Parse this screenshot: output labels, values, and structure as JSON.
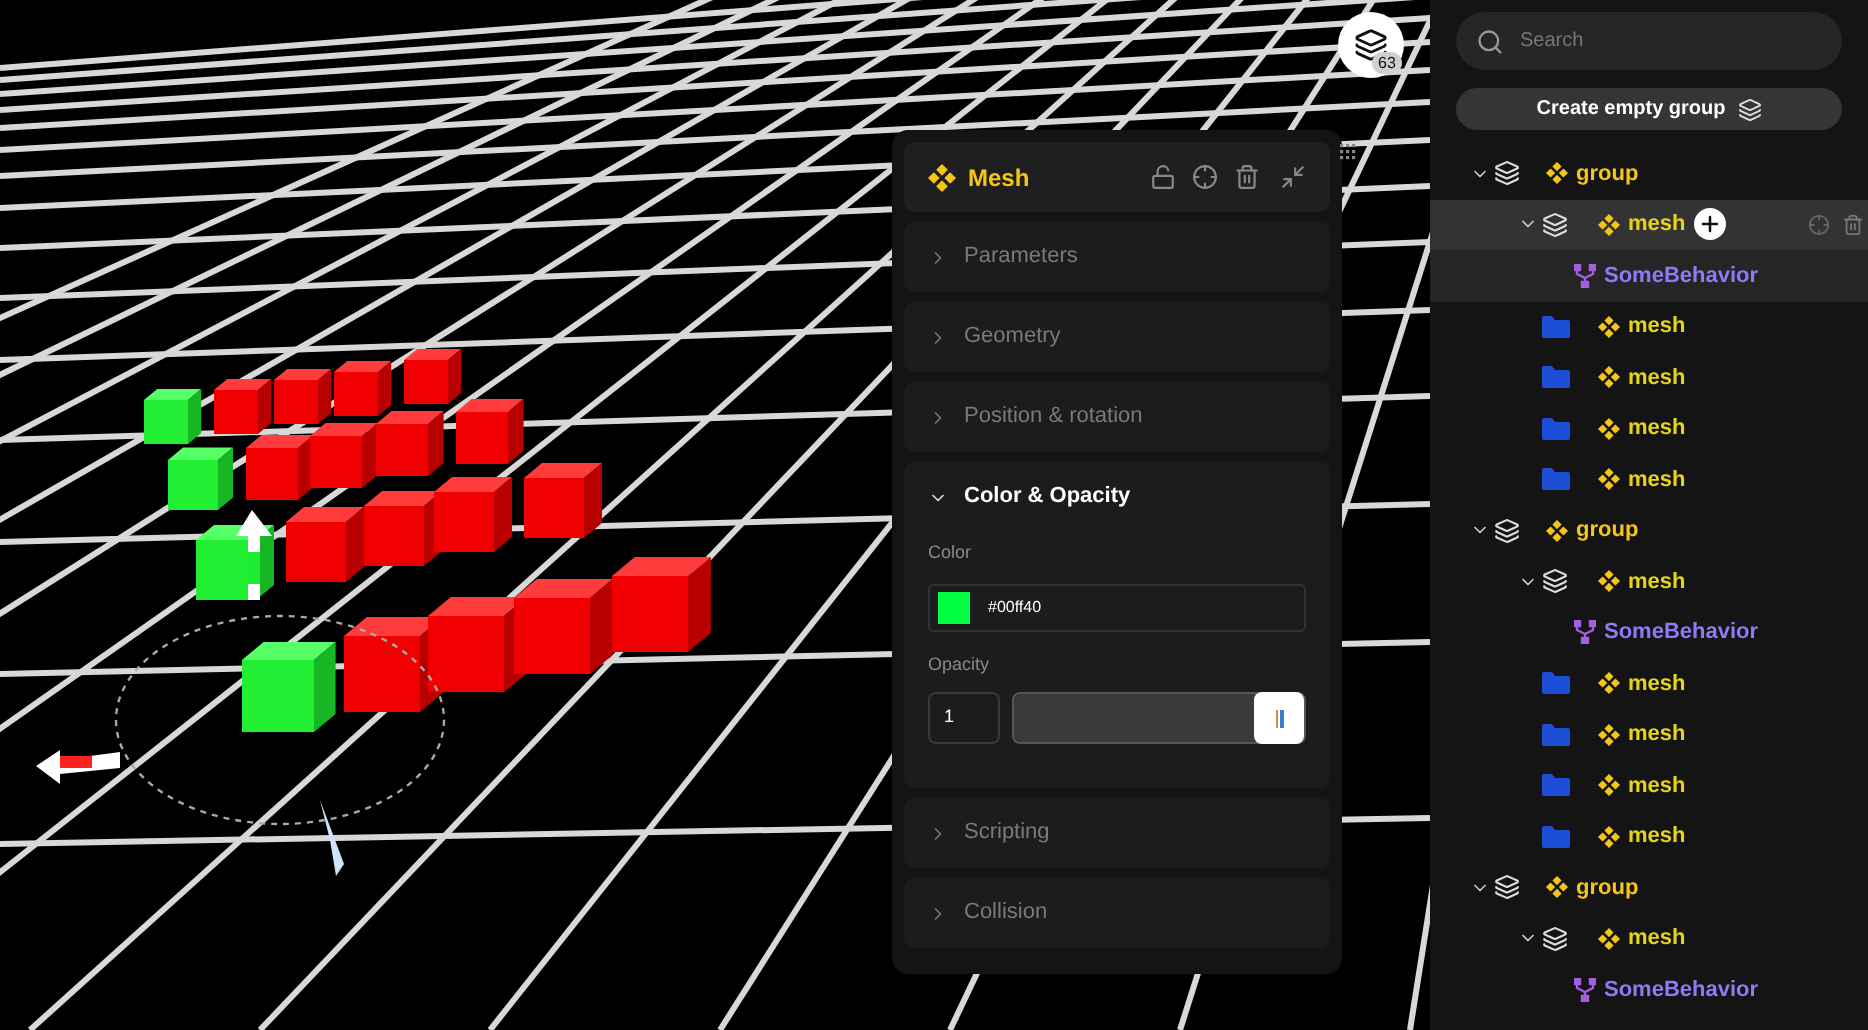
{
  "viewport": {
    "layers_count": "63"
  },
  "inspector": {
    "title": "Mesh",
    "sections": [
      {
        "label": "Parameters",
        "expanded": false
      },
      {
        "label": "Geometry",
        "expanded": false
      },
      {
        "label": "Position & rotation",
        "expanded": false
      },
      {
        "label": "Color & Opacity",
        "expanded": true
      },
      {
        "label": "Scripting",
        "expanded": false
      },
      {
        "label": "Collision",
        "expanded": false
      }
    ],
    "color": {
      "label": "Color",
      "value": "#00ff40"
    },
    "opacity": {
      "label": "Opacity",
      "value": "1",
      "level": 1
    }
  },
  "outliner": {
    "search": {
      "placeholder": "Search"
    },
    "create_button": "Create empty group",
    "tree": [
      {
        "kind": "group",
        "label": "group",
        "expanded": true,
        "selected": false,
        "children": [
          {
            "kind": "mesh",
            "label": "mesh",
            "expanded": true,
            "selected": true,
            "children": [
              {
                "kind": "behavior",
                "label": "SomeBehavior",
                "selected": false
              }
            ]
          },
          {
            "kind": "mesh",
            "label": "mesh",
            "selected": false
          },
          {
            "kind": "mesh",
            "label": "mesh",
            "selected": false
          },
          {
            "kind": "mesh",
            "label": "mesh",
            "selected": false
          },
          {
            "kind": "mesh",
            "label": "mesh",
            "selected": false
          }
        ]
      },
      {
        "kind": "group",
        "label": "group",
        "expanded": true,
        "selected": false,
        "children": [
          {
            "kind": "mesh",
            "label": "mesh",
            "expanded": true,
            "selected": false,
            "children": [
              {
                "kind": "behavior",
                "label": "SomeBehavior",
                "selected": false
              }
            ]
          },
          {
            "kind": "mesh",
            "label": "mesh",
            "selected": false
          },
          {
            "kind": "mesh",
            "label": "mesh",
            "selected": false
          },
          {
            "kind": "mesh",
            "label": "mesh",
            "selected": false
          },
          {
            "kind": "mesh",
            "label": "mesh",
            "selected": false
          }
        ]
      },
      {
        "kind": "group",
        "label": "group",
        "expanded": true,
        "selected": false,
        "children": [
          {
            "kind": "mesh",
            "label": "mesh",
            "expanded": true,
            "selected": false,
            "children": [
              {
                "kind": "behavior",
                "label": "SomeBehavior",
                "selected": false
              }
            ]
          }
        ]
      }
    ]
  }
}
